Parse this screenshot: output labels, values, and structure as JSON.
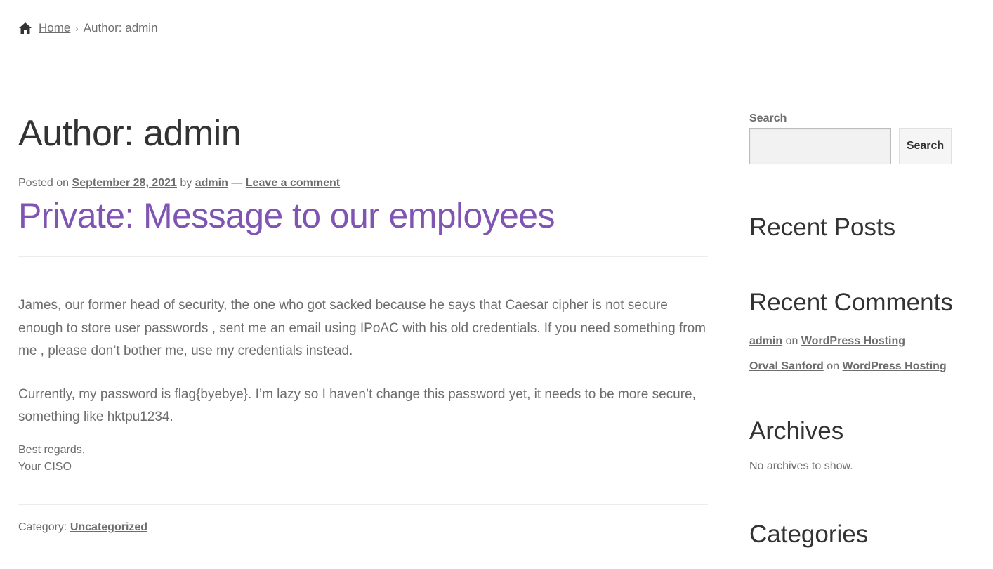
{
  "breadcrumb": {
    "home": "Home",
    "separator": "›",
    "current": "Author: admin"
  },
  "main": {
    "page_title": "Author: admin",
    "meta": {
      "posted_on": "Posted on",
      "date": "September 28, 2021",
      "by": "by",
      "author": "admin",
      "dash": "—",
      "comment_link": "Leave a comment"
    },
    "post_title": "Private: Message to our employees",
    "paragraph1": "James, our former head of security, the one who got sacked because he says that Caesar cipher is not secure enough to store user passwords , sent me an email using IPoAC with his old credentials. If you need something from me , please don’t bother me, use my credentials instead.",
    "paragraph2": "Currently, my password is flag{byebye}. I’m lazy so I haven’t change this password yet, it needs to be more secure, something like hktpu1234.",
    "signature_line1": "Best regards,",
    "signature_line2": "Your CISO",
    "category_label": "Category:",
    "category": "Uncategorized"
  },
  "sidebar": {
    "search_label": "Search",
    "search_value": "",
    "search_button": "Search",
    "recent_posts_title": "Recent Posts",
    "recent_comments_title": "Recent Comments",
    "comments": [
      {
        "author": "admin",
        "on": "on",
        "post": "WordPress Hosting"
      },
      {
        "author": "Orval Sanford",
        "on": "on",
        "post": "WordPress Hosting"
      }
    ],
    "archives_title": "Archives",
    "archives_empty": "No archives to show.",
    "categories_title": "Categories"
  },
  "colors": {
    "accent": "#7f54b3",
    "text": "#6d6d6d",
    "heading": "#333333"
  },
  "icons": {
    "home": "home-icon"
  }
}
